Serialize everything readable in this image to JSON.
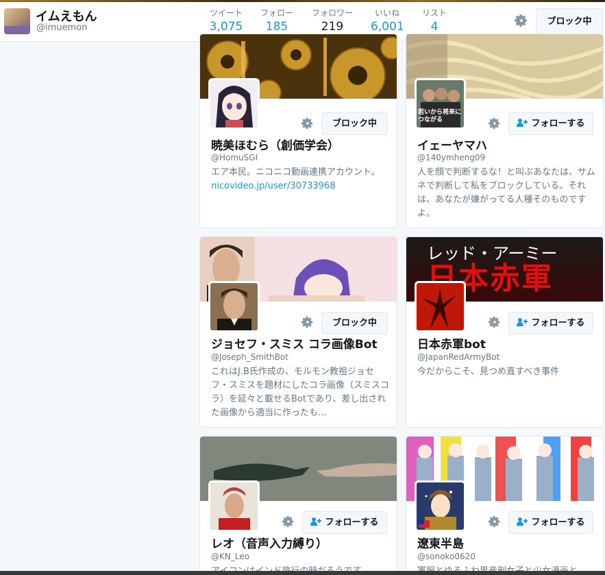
{
  "profile": {
    "name": "イムえもん",
    "handle": "@imuemon"
  },
  "stats": [
    {
      "label": "ツイート",
      "value": "3,075"
    },
    {
      "label": "フォロー",
      "value": "185"
    },
    {
      "label": "フォロワー",
      "value": "219"
    },
    {
      "label": "いいね",
      "value": "6,001"
    },
    {
      "label": "リスト",
      "value": "4"
    }
  ],
  "header": {
    "block_button": "ブロック中"
  },
  "cards": [
    {
      "name": "暁美ほむら（創価学会）",
      "handle": "@HomuSGI",
      "bio": "エア本民。ニコニコ動画連携アカウント。",
      "link": "nicovideo.jp/user/30733968",
      "button": "ブロック中"
    },
    {
      "name": "イェーヤマハ",
      "handle": "@140ymheng09",
      "bio": "人を顔で判断するな！と叫ぶあなたは、サムネで判断して私をブロックしている。それは、あなたが嫌がってる人種そのものですよ。",
      "button": "フォローする",
      "avatar_text": "若いから将来につながる"
    },
    {
      "name": "ジョセフ・スミス コラ画像Bot",
      "handle": "@Joseph_SmithBot",
      "bio": "これはJ.B氏作成の、モルモン教祖ジョセフ・スミスを題材にしたコラ画像（スミスコラ）を延々と載せるBotであり、差し出された画像から適当に作ったも...",
      "button": "ブロック中"
    },
    {
      "name": "日本赤軍bot",
      "handle": "@JapanRedArmyBot",
      "bio": "今だからこそ、見つめ直すべき事件",
      "button": "フォローする",
      "banner_text_top": "レッド・アーミー",
      "banner_text_main": "日本赤軍"
    },
    {
      "name": "レオ（音声入力縛り）",
      "handle": "@KN_Leo",
      "bio": "アイコンはインド旅行の時だろうです",
      "button": "フォローする"
    },
    {
      "name": "遼東半島",
      "handle": "@sonoko0620",
      "bio": "軍服とゆるふわ男産刑女子と少女漫画と",
      "button": "フォローする"
    }
  ],
  "colors": {
    "accent": "#1b95e0",
    "border": "#e1e8ed",
    "background": "#f5f8fa"
  }
}
